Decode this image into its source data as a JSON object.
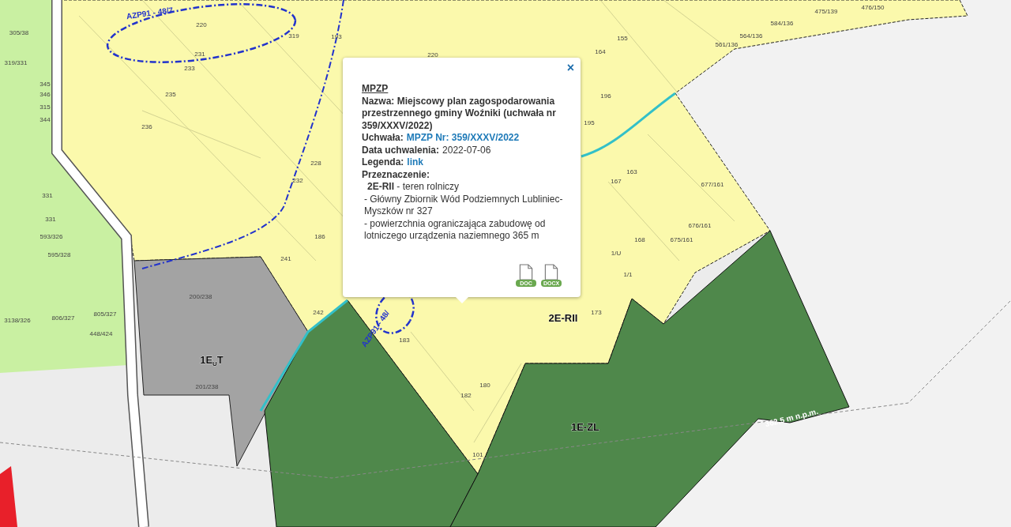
{
  "popup": {
    "close": "×",
    "title": "MPZP",
    "name_label": "Nazwa:",
    "name_value": "Miejscowy plan zagospodarowania przestrzennego gminy Woźniki (uchwała nr 359/XXXV/2022)",
    "fields": [
      {
        "label": "Uchwała:",
        "value": "MPZP Nr: 359/XXXV/2022",
        "kind": "link"
      },
      {
        "label": "Data uchwalenia:",
        "value": "2022-07-06",
        "kind": "text"
      },
      {
        "label": "Legenda:",
        "value": "link",
        "kind": "link"
      }
    ],
    "purpose_label": "Przeznaczenie:",
    "purposes": [
      {
        "text": "**2E-RII** - teren rolniczy",
        "kind": "main"
      },
      {
        "text": "- Główny Zbiornik Wód Podziemnych Lubliniec-Myszków nr 327",
        "kind": "note"
      },
      {
        "text": "- powierzchnia ograniczająca zabudowę od lotniczego urządzenia naziemnego 365 m",
        "kind": "note"
      }
    ],
    "downloads": [
      {
        "label": "DOC"
      },
      {
        "label": "DOCX"
      }
    ]
  },
  "map": {
    "labels": [
      {
        "text": "AZP91 - 48/7",
        "kind": "site"
      },
      {
        "text": "AZP91 - 48/",
        "kind": "site"
      },
      {
        "text": "2E-RII",
        "kind": "zone"
      },
      {
        "text": "1E-ZL",
        "kind": "zone"
      },
      {
        "text": "1E$_{U}$T",
        "kind": "zone"
      },
      {
        "text": "362,5 m n.p.m.",
        "kind": "height"
      },
      {
        "text": "220",
        "kind": "parcel"
      },
      {
        "text": "231",
        "kind": "parcel"
      },
      {
        "text": "233",
        "kind": "parcel"
      },
      {
        "text": "235",
        "kind": "parcel"
      },
      {
        "text": "236",
        "kind": "parcel"
      },
      {
        "text": "228",
        "kind": "parcel"
      },
      {
        "text": "232",
        "kind": "parcel"
      },
      {
        "text": "186",
        "kind": "parcel"
      },
      {
        "text": "241",
        "kind": "parcel"
      },
      {
        "text": "242",
        "kind": "parcel"
      },
      {
        "text": "319",
        "kind": "parcel"
      },
      {
        "text": "193",
        "kind": "parcel"
      },
      {
        "text": "220",
        "kind": "parcel"
      },
      {
        "text": "155",
        "kind": "parcel"
      },
      {
        "text": "164",
        "kind": "parcel"
      },
      {
        "text": "196",
        "kind": "parcel"
      },
      {
        "text": "195",
        "kind": "parcel"
      },
      {
        "text": "163",
        "kind": "parcel"
      },
      {
        "text": "167",
        "kind": "parcel"
      },
      {
        "text": "168",
        "kind": "parcel"
      },
      {
        "text": "675/161",
        "kind": "parcel"
      },
      {
        "text": "676/161",
        "kind": "parcel"
      },
      {
        "text": "677/161",
        "kind": "parcel"
      },
      {
        "text": "1/U",
        "kind": "parcel"
      },
      {
        "text": "1/1",
        "kind": "parcel"
      },
      {
        "text": "173",
        "kind": "parcel"
      },
      {
        "text": "183",
        "kind": "parcel"
      },
      {
        "text": "182",
        "kind": "parcel"
      },
      {
        "text": "180",
        "kind": "parcel"
      },
      {
        "text": "101",
        "kind": "parcel"
      },
      {
        "text": "584/136",
        "kind": "parcel"
      },
      {
        "text": "564/136",
        "kind": "parcel"
      },
      {
        "text": "561/136",
        "kind": "parcel"
      },
      {
        "text": "475/139",
        "kind": "parcel"
      },
      {
        "text": "476/150",
        "kind": "parcel"
      },
      {
        "text": "305/38",
        "kind": "parcel"
      },
      {
        "text": "319/331",
        "kind": "parcel"
      },
      {
        "text": "345",
        "kind": "parcel"
      },
      {
        "text": "346",
        "kind": "parcel"
      },
      {
        "text": "315",
        "kind": "parcel"
      },
      {
        "text": "344",
        "kind": "parcel"
      },
      {
        "text": "331",
        "kind": "parcel"
      },
      {
        "text": "331",
        "kind": "parcel"
      },
      {
        "text": "593/326",
        "kind": "parcel"
      },
      {
        "text": "595/328",
        "kind": "parcel"
      },
      {
        "text": "3138/326",
        "kind": "parcel"
      },
      {
        "text": "806/327",
        "kind": "parcel"
      },
      {
        "text": "805/327",
        "kind": "parcel"
      },
      {
        "text": "448/424",
        "kind": "parcel"
      },
      {
        "text": "200/238",
        "kind": "parcel"
      },
      {
        "text": "201/238",
        "kind": "parcel"
      }
    ]
  }
}
